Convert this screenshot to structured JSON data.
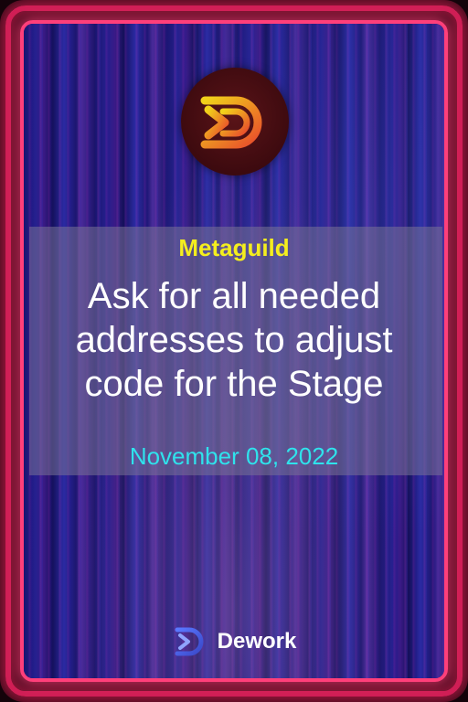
{
  "organization": "Metaguild",
  "task_title": "Ask for all needed addresses to adjust code for the Stage",
  "date": "November 08, 2022",
  "brand": {
    "name": "Dework",
    "icon": "dework-logo-icon"
  },
  "logo_icon": "metaguild-logo-icon",
  "colors": {
    "frame": "#ff3f7a",
    "organization_text": "#f4ee1e",
    "title_text": "#ffffff",
    "date_text": "#2fe3ec",
    "logo_gradient_start": "#f0c020",
    "logo_gradient_end": "#e8502a"
  }
}
